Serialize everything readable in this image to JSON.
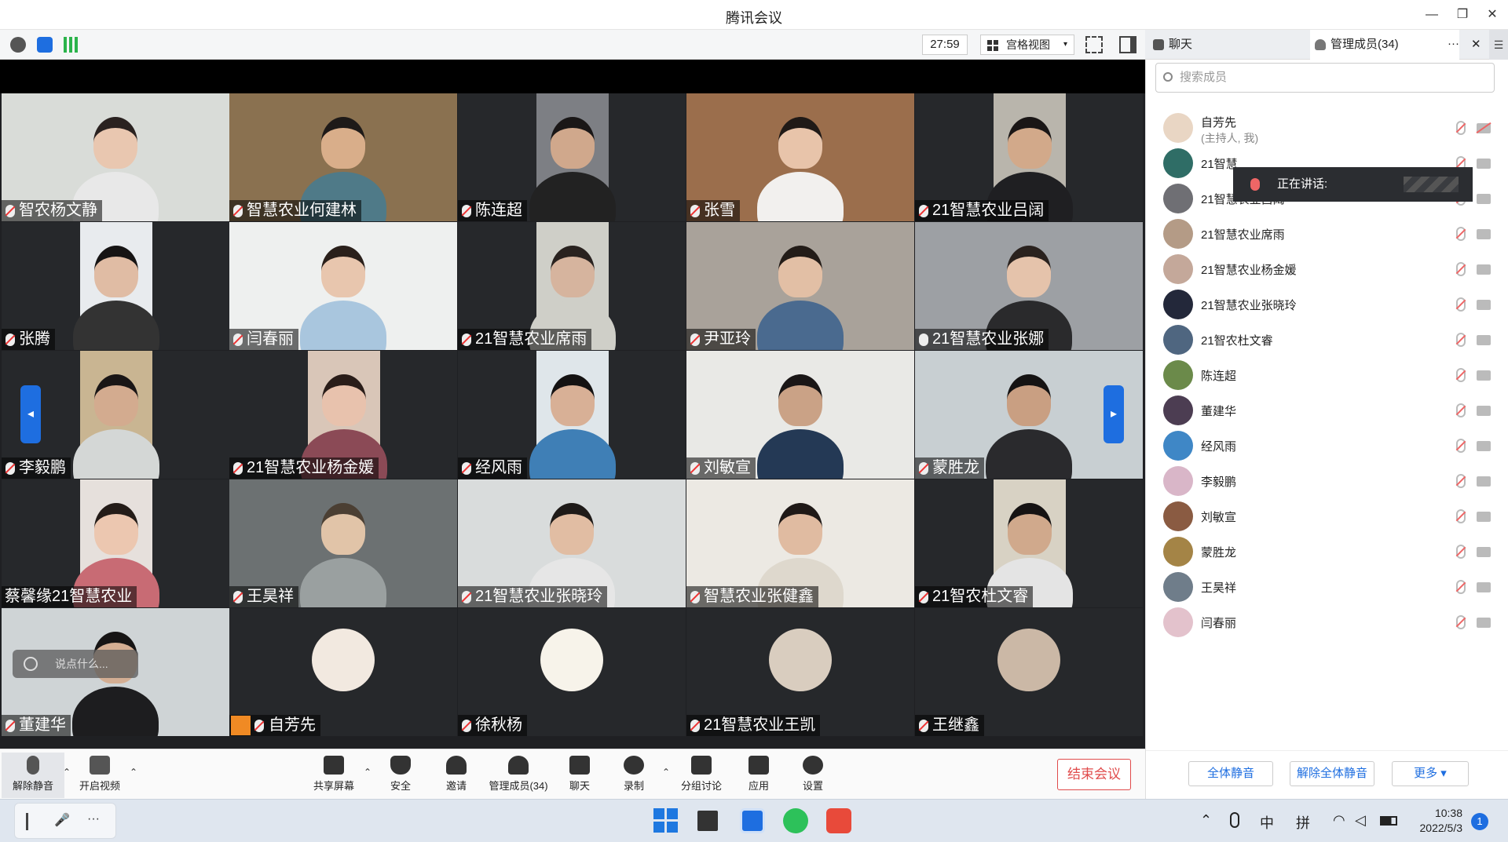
{
  "window": {
    "title": "腾讯会议",
    "min": "—",
    "max": "❐",
    "close": "✕"
  },
  "toolbar": {
    "timer": "27:59",
    "view_mode": "宫格视图"
  },
  "side_tabs": {
    "chat": "聊天",
    "members": "管理成员(34)",
    "more": "···",
    "close": "✕"
  },
  "tiles": [
    {
      "name": "智农杨文静",
      "mic": "muted",
      "bg": "#d9dcd8",
      "skin": "#e9c7b0",
      "hair": "#2a2220",
      "shirt": "#e8e8e8"
    },
    {
      "name": "智慧农业何建林",
      "mic": "muted",
      "bg": "#8a7150",
      "skin": "#d9ae8a",
      "hair": "#1e1a18",
      "shirt": "#4f7a88"
    },
    {
      "name": "陈连超",
      "mic": "muted",
      "bg": "#7d7f84",
      "skin": "#d0a88c",
      "hair": "#1a1717",
      "shirt": "#222"
    },
    {
      "name": "张雪",
      "mic": "muted",
      "bg": "#9b6e4c",
      "skin": "#e8c4aa",
      "hair": "#201a17",
      "shirt": "#f2f0ee"
    },
    {
      "name": "21智慧农业吕阔",
      "mic": "muted",
      "bg": "#b9b5ac",
      "skin": "#d2a98a",
      "hair": "#1a1616",
      "shirt": "#1f1f22"
    },
    {
      "name": "张腾",
      "mic": "muted",
      "bg": "#e8ebee",
      "skin": "#e0bca4",
      "hair": "#161414",
      "shirt": "#333"
    },
    {
      "name": "闫春丽",
      "mic": "muted",
      "bg": "#eef0ef",
      "skin": "#e8c6ae",
      "hair": "#2a201b",
      "shirt": "#a9c6de"
    },
    {
      "name": "21智慧农业席雨",
      "mic": "muted",
      "bg": "#cfcfc8",
      "skin": "#d6b49e",
      "hair": "#29221f",
      "shirt": "#cfcfc8"
    },
    {
      "name": "尹亚玲",
      "mic": "muted",
      "bg": "#a9a29a",
      "skin": "#e2bfa5",
      "hair": "#231c18",
      "shirt": "#4a6a8f"
    },
    {
      "name": "21智慧农业张娜",
      "mic": "on",
      "bg": "#9da0a4",
      "skin": "#e5c3ab",
      "hair": "#2a221e",
      "shirt": "#2a2a2c"
    },
    {
      "name": "李毅鹏",
      "mic": "muted",
      "bg": "#c9b592",
      "skin": "#d3ab8f",
      "hair": "#1a1616",
      "shirt": "#d4d7d6"
    },
    {
      "name": "21智慧农业杨金媛",
      "mic": "muted",
      "bg": "#d9c6b8",
      "skin": "#e8c2ad",
      "hair": "#2a1d19",
      "shirt": "#8b4a56"
    },
    {
      "name": "经风雨",
      "mic": "muted",
      "bg": "#dfe6ea",
      "skin": "#d8b096",
      "hair": "#141212",
      "shirt": "#3f7fb6"
    },
    {
      "name": "刘敏宣",
      "mic": "muted",
      "bg": "#e9e9e6",
      "skin": "#caa286",
      "hair": "#1a1616",
      "shirt": "#243955"
    },
    {
      "name": "蒙胜龙",
      "mic": "muted",
      "bg": "#c8cfd2",
      "skin": "#c99f82",
      "hair": "#151313",
      "shirt": "#2a2a2d"
    },
    {
      "name": "蔡馨缘21智慧农业",
      "mic": "none",
      "bg": "#e6e0dc",
      "skin": "#ecc7b0",
      "hair": "#241c18",
      "shirt": "#c86b74"
    },
    {
      "name": "王昊祥",
      "mic": "muted",
      "bg": "#6c7172",
      "skin": "#e1c4a8",
      "hair": "#4b3f33",
      "shirt": "#9aa0a0"
    },
    {
      "name": "21智慧农业张晓玲",
      "mic": "muted",
      "bg": "#d9dcdc",
      "skin": "#e1bda3",
      "hair": "#1e1a18",
      "shirt": "#e6e6e6"
    },
    {
      "name": "智慧农业张健鑫",
      "mic": "muted",
      "bg": "#ece9e3",
      "skin": "#e0bba1",
      "hair": "#1f1917",
      "shirt": "#ded8cd"
    },
    {
      "name": "21智农杜文睿",
      "mic": "muted",
      "bg": "#d8d2c4",
      "skin": "#d0a98c",
      "hair": "#161313",
      "shirt": "#e4e4e4"
    },
    {
      "name": "董建华",
      "mic": "muted",
      "bg": "#cfd4d6",
      "skin": "#d4ae93",
      "hair": "#171515",
      "shirt": "#1d1d1f"
    },
    {
      "name": "自芳先",
      "mic": "muted",
      "avatar": "#f2e9e0",
      "host": true
    },
    {
      "name": "徐秋杨",
      "mic": "muted",
      "avatar": "#f7f3ea"
    },
    {
      "name": "21智慧农业王凯",
      "mic": "muted",
      "avatar": "#d9cdbf"
    },
    {
      "name": "王继鑫",
      "mic": "muted",
      "avatar": "#cbb8a6"
    }
  ],
  "chat_placeholder": "说点什么...",
  "bottom": {
    "unmute": "解除静音",
    "start_video": "开启视频",
    "share": "共享屏幕",
    "security": "安全",
    "invite": "邀请",
    "manage": "管理成员(34)",
    "chat": "聊天",
    "record": "录制",
    "breakout": "分组讨论",
    "apps": "应用",
    "settings": "设置",
    "end": "结束会议"
  },
  "side": {
    "search_placeholder": "搜索成员",
    "speaking_label": "正在讲话:",
    "members": [
      {
        "name": "自芳先",
        "sub": "(主持人, 我)",
        "color": "#e9d6c4"
      },
      {
        "name": "21智慧",
        "color": "#2f6d66"
      },
      {
        "name": "21智慧农业吕阔",
        "color": "#6f6f74"
      },
      {
        "name": "21智慧农业席雨",
        "color": "#b49b86"
      },
      {
        "name": "21智慧农业杨金媛",
        "color": "#c4a89a"
      },
      {
        "name": "21智慧农业张晓玲",
        "color": "#23283a"
      },
      {
        "name": "21智农杜文睿",
        "color": "#4f6680"
      },
      {
        "name": "陈连超",
        "color": "#6b8a4a"
      },
      {
        "name": "董建华",
        "color": "#4c3d52"
      },
      {
        "name": "经风雨",
        "color": "#3f87c6"
      },
      {
        "name": "李毅鹏",
        "color": "#d9b6c8"
      },
      {
        "name": "刘敏宣",
        "color": "#8a5b42"
      },
      {
        "name": "蒙胜龙",
        "color": "#a48446"
      },
      {
        "name": "王昊祥",
        "color": "#6f7d8a"
      },
      {
        "name": "闫春丽",
        "color": "#e3c2cc"
      }
    ],
    "mute_all": "全体静音",
    "unmute_all": "解除全体静音",
    "more": "更多 ▾"
  },
  "taskbar": {
    "ime1": "中",
    "ime2": "拼",
    "time": "10:38",
    "date": "2022/5/3",
    "badge": "1",
    "widget_mic": "🎤",
    "widget_more": "···"
  }
}
